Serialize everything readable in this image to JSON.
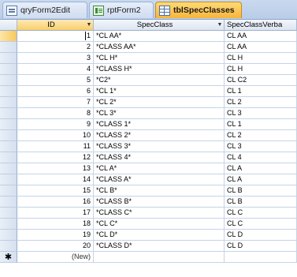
{
  "tabs": [
    {
      "label": "qryForm2Edit",
      "icon": "form-icon"
    },
    {
      "label": "rptForm2",
      "icon": "report-icon"
    },
    {
      "label": "tblSpecClasses",
      "icon": "table-icon",
      "active": true
    }
  ],
  "columns": {
    "id": "ID",
    "spec": "SpecClass",
    "verb": "SpecClassVerba"
  },
  "rows": [
    {
      "id": "1",
      "spec": "*CL AA*",
      "verb": "CL AA"
    },
    {
      "id": "2",
      "spec": "*CLASS AA*",
      "verb": "CL AA"
    },
    {
      "id": "3",
      "spec": "*CL H*",
      "verb": "CL H"
    },
    {
      "id": "4",
      "spec": "*CLASS H*",
      "verb": "CL H"
    },
    {
      "id": "5",
      "spec": "*C2*",
      "verb": "CL C2"
    },
    {
      "id": "6",
      "spec": "*CL 1*",
      "verb": "CL 1"
    },
    {
      "id": "7",
      "spec": "*CL 2*",
      "verb": "CL 2"
    },
    {
      "id": "8",
      "spec": "*CL 3*",
      "verb": "CL 3"
    },
    {
      "id": "9",
      "spec": "*CLASS 1*",
      "verb": "CL 1"
    },
    {
      "id": "10",
      "spec": "*CLASS 2*",
      "verb": "CL 2"
    },
    {
      "id": "11",
      "spec": "*CLASS 3*",
      "verb": "CL 3"
    },
    {
      "id": "12",
      "spec": "*CLASS 4*",
      "verb": "CL 4"
    },
    {
      "id": "13",
      "spec": "*CL A*",
      "verb": "CL A"
    },
    {
      "id": "14",
      "spec": "*CLASS A*",
      "verb": "CL A"
    },
    {
      "id": "15",
      "spec": "*CL B*",
      "verb": "CL B"
    },
    {
      "id": "16",
      "spec": "*CLASS B*",
      "verb": "CL B"
    },
    {
      "id": "17",
      "spec": "*CLASS C*",
      "verb": "CL C"
    },
    {
      "id": "18",
      "spec": "*CL C*",
      "verb": "CL C"
    },
    {
      "id": "19",
      "spec": "*CL D*",
      "verb": "CL D"
    },
    {
      "id": "20",
      "spec": "*CLASS D*",
      "verb": "CL D"
    }
  ],
  "new_row": {
    "marker": "✱",
    "id": "(New)"
  },
  "colors": {
    "active_tab": "#f6b53a",
    "header": "#dbe5f1",
    "grid_line": "#c6d3e6"
  }
}
